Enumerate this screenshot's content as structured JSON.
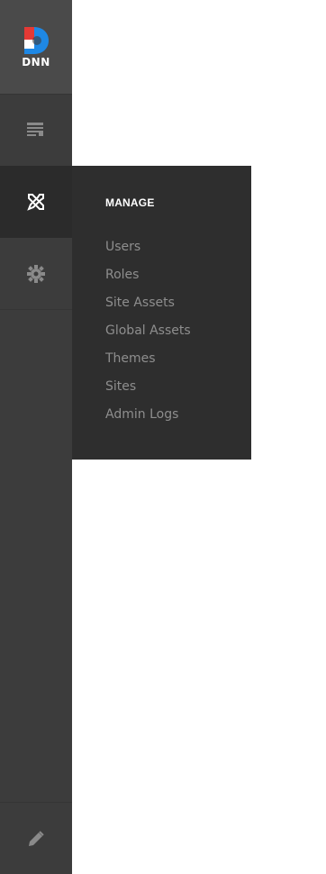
{
  "brand": {
    "logo_text": "DNN",
    "colors": {
      "blue": "#1e88e5",
      "red": "#e53935",
      "white": "#ffffff"
    }
  },
  "sidebar": {
    "background": "#3c3c3c",
    "items": [
      {
        "id": "pages",
        "icon": "pages-icon"
      },
      {
        "id": "manage",
        "icon": "wrench-screwdriver-icon",
        "active": true
      },
      {
        "id": "settings",
        "icon": "gear-icon"
      },
      {
        "id": "edit",
        "icon": "pencil-icon"
      }
    ]
  },
  "flyout": {
    "title": "MANAGE",
    "items": [
      {
        "label": "Users"
      },
      {
        "label": "Roles"
      },
      {
        "label": "Site Assets"
      },
      {
        "label": "Global Assets"
      },
      {
        "label": "Themes"
      },
      {
        "label": "Sites"
      },
      {
        "label": "Admin Logs"
      }
    ]
  }
}
